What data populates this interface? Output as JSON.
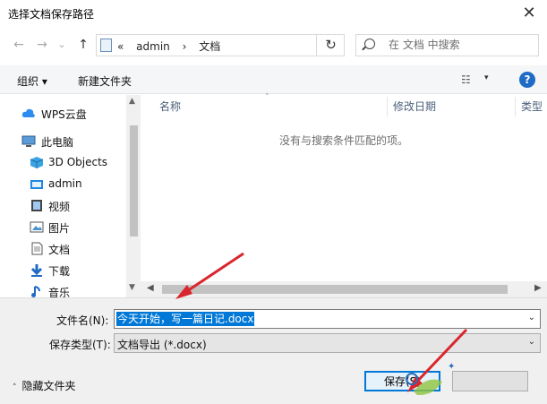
{
  "window": {
    "title": "选择文档保存路径",
    "close_glyph": "✕"
  },
  "navbar": {
    "back_glyph": "←",
    "forward_glyph": "→",
    "recent_glyph": "⌄",
    "up_glyph": "↑",
    "breadcrumbs": [
      "«",
      "admin",
      "›",
      "文档"
    ],
    "address_drop_glyph": "⌄",
    "refresh_glyph": "↻",
    "search_placeholder": "在 文档 中搜索"
  },
  "toolbar": {
    "organize": "组织 ▾",
    "new_folder": "新建文件夹",
    "view_glyph": "☷",
    "view_drop_glyph": "▾",
    "help_glyph": "?"
  },
  "sidebar": {
    "items": [
      {
        "label": "WPS云盘",
        "icon": "cloud-icon"
      },
      {
        "label": "此电脑",
        "icon": "computer-icon"
      },
      {
        "label": "3D Objects",
        "icon": "cube-icon"
      },
      {
        "label": "admin",
        "icon": "folder-icon"
      },
      {
        "label": "视频",
        "icon": "video-icon"
      },
      {
        "label": "图片",
        "icon": "picture-icon"
      },
      {
        "label": "文档",
        "icon": "document-icon"
      },
      {
        "label": "下载",
        "icon": "download-icon"
      },
      {
        "label": "音乐",
        "icon": "music-icon"
      }
    ]
  },
  "list": {
    "columns": [
      "名称",
      "修改日期",
      "类型"
    ],
    "sort_glyph": "˄",
    "empty_message": "没有与搜索条件匹配的项。"
  },
  "form": {
    "filename_label": "文件名(N):",
    "filename_value": "今天开始，写一篇日记.docx",
    "filetype_label": "保存类型(T):",
    "filetype_value": "文档导出 (*.docx)",
    "dropdown_glyph": "⌄"
  },
  "footer": {
    "hide_folders": "隐藏文件夹",
    "hide_glyph": "˄",
    "save_button": "保存(S)",
    "cancel_button": ""
  },
  "colors": {
    "accent": "#0078d7",
    "annotation_arrow": "#d9262c"
  }
}
